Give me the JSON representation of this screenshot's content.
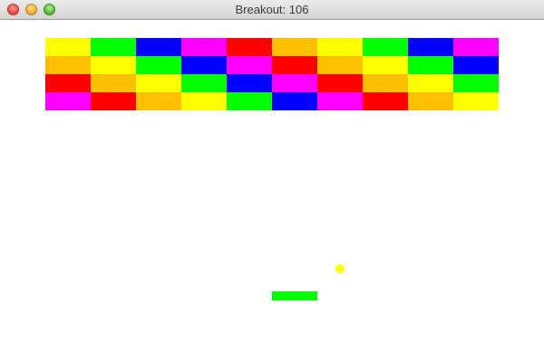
{
  "window": {
    "title": "Breakout: 106",
    "controls": [
      "close-icon",
      "minimize-icon",
      "zoom-icon"
    ]
  },
  "game": {
    "colors": {
      "yellow": "#ffff00",
      "green": "#00ff00",
      "blue": "#0000ff",
      "magenta": "#ff00ff",
      "red": "#ff0000",
      "orange": "#ffc000"
    },
    "bricks": [
      [
        "yellow",
        "green",
        "blue",
        "magenta",
        "red",
        "orange",
        "yellow",
        "green",
        "blue",
        "magenta"
      ],
      [
        "orange",
        "yellow",
        "green",
        "blue",
        "magenta",
        "red",
        "orange",
        "yellow",
        "green",
        "blue"
      ],
      [
        "red",
        "orange",
        "yellow",
        "green",
        "blue",
        "magenta",
        "red",
        "orange",
        "yellow",
        "green"
      ],
      [
        "magenta",
        "red",
        "orange",
        "yellow",
        "green",
        "blue",
        "magenta",
        "red",
        "orange",
        "yellow"
      ]
    ],
    "ball_color": "#ffff00",
    "paddle_color": "#00ff00"
  }
}
